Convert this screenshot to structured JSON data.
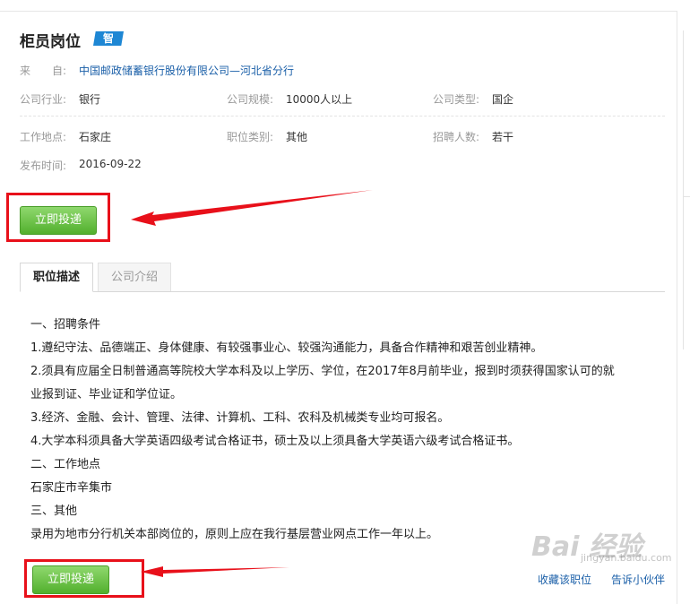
{
  "job": {
    "title": "柜员岗位",
    "badge": "智",
    "source_label": "来　　自:",
    "source_value": "中国邮政储蓄银行股份有限公司—河北省分行",
    "industry_label": "公司行业:",
    "industry_value": "银行",
    "scale_label": "公司规模:",
    "scale_value": "10000人以上",
    "type_label": "公司类型:",
    "type_value": "国企",
    "location_label": "工作地点:",
    "location_value": "石家庄",
    "category_label": "职位类别:",
    "category_value": "其他",
    "headcount_label": "招聘人数:",
    "headcount_value": "若干",
    "date_label": "发布时间:",
    "date_value": "2016-09-22"
  },
  "actions": {
    "apply_label": "立即投递",
    "favorite_label": "收藏该职位",
    "tell_friend_label": "告诉小伙伴"
  },
  "tabs": [
    {
      "label": "职位描述",
      "active": true
    },
    {
      "label": "公司介绍",
      "active": false
    }
  ],
  "description": [
    "一、招聘条件",
    "1.遵纪守法、品德端正、身体健康、有较强事业心、较强沟通能力，具备合作精神和艰苦创业精神。",
    "2.须具有应届全日制普通高等院校大学本科及以上学历、学位，在2017年8月前毕业，报到时须获得国家认可的就",
    "业报到证、毕业证和学位证。",
    "3.经济、金融、会计、管理、法律、计算机、工科、农科及机械类专业均可报名。",
    "4.大学本科须具备大学英语四级考试合格证书，硕士及以上须具备大学英语六级考试合格证书。",
    "二、工作地点",
    "石家庄市辛集市",
    "三、其他",
    "录用为地市分行机关本部岗位的，原则上应在我行基层营业网点工作一年以上。"
  ],
  "watermark": {
    "brand": "Bai 经验",
    "sub": "jingyan.baidu.com"
  },
  "colors": {
    "annotation_red": "#e8101a",
    "button_green": "#52b02d",
    "link_blue": "#1a5fa8",
    "badge_blue": "#1e87d4"
  }
}
